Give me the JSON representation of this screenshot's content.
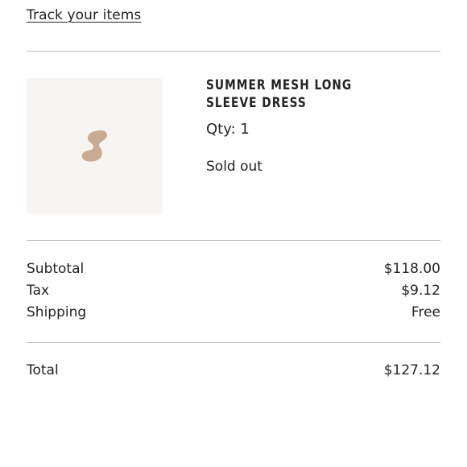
{
  "header": {
    "track_link_label": "Track your items"
  },
  "item": {
    "title": "SUMMER MESH LONG SLEEVE DRESS",
    "quantity": "Qty: 1",
    "availability": "Sold out",
    "placeholder_icon": "brand-s-logo-icon",
    "placeholder_color": "#c9ab91",
    "thumbnail_bg": "#f7f5f2"
  },
  "summary": {
    "subtotal_label": "Subtotal",
    "subtotal_value": "$118.00",
    "tax_label": "Tax",
    "tax_value": "$9.12",
    "shipping_label": "Shipping",
    "shipping_value": "Free",
    "total_label": "Total",
    "total_value": "$127.12"
  }
}
